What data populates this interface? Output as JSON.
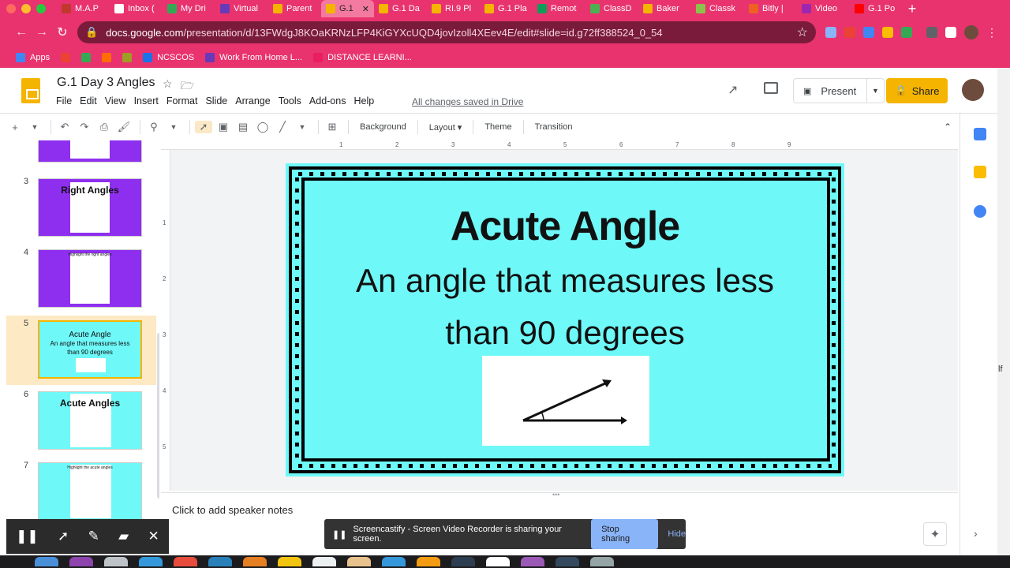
{
  "browser": {
    "tabs": [
      {
        "label": "M.A.P",
        "color": "#c0392b"
      },
      {
        "label": "Inbox (",
        "color": "#ffffff"
      },
      {
        "label": "My Dri",
        "color": "#34a853"
      },
      {
        "label": "Virtual",
        "color": "#673ab7"
      },
      {
        "label": "Parent",
        "color": "#f4b400"
      },
      {
        "label": "G.1",
        "color": "#f4b400",
        "active": true
      },
      {
        "label": "G.1 Da",
        "color": "#f4b400"
      },
      {
        "label": "RI.9 Pl",
        "color": "#f4b400"
      },
      {
        "label": "G.1 Pla",
        "color": "#f4b400"
      },
      {
        "label": "Remot",
        "color": "#0f9d58"
      },
      {
        "label": "ClassD",
        "color": "#4caf50"
      },
      {
        "label": "Baker",
        "color": "#f4b400"
      },
      {
        "label": "Classk",
        "color": "#8bc34a"
      },
      {
        "label": "Bitly |",
        "color": "#ee6123"
      },
      {
        "label": "Video",
        "color": "#9c27b0"
      },
      {
        "label": "G.1 Po",
        "color": "#ff0000"
      }
    ],
    "url_host": "docs.google.com",
    "url_path": "/presentation/d/13FWdgJ8KOaKRNzLFP4KiGYXcUQD4jovIzoll4XEev4E/edit#slide=id.g72ff388524_0_54",
    "bookmarks": [
      {
        "label": "Apps",
        "color": "#4285f4"
      },
      {
        "label": "",
        "color": "#ea4335"
      },
      {
        "label": "",
        "color": "#34a853"
      },
      {
        "label": "",
        "color": "#ff6d00"
      },
      {
        "label": "",
        "color": "#9e9d24"
      },
      {
        "label": "NCSCOS",
        "color": "#1a73e8"
      },
      {
        "label": "Work From Home L...",
        "color": "#673ab7"
      },
      {
        "label": "DISTANCE LEARNI...",
        "color": "#e91e63"
      }
    ]
  },
  "app": {
    "title": "G.1 Day 3 Angles",
    "menus": [
      "File",
      "Edit",
      "View",
      "Insert",
      "Format",
      "Slide",
      "Arrange",
      "Tools",
      "Add-ons",
      "Help"
    ],
    "save_status": "All changes saved in Drive",
    "present_label": "Present",
    "share_label": "Share",
    "toolbar_text_buttons": [
      "Background",
      "Layout",
      "Theme",
      "Transition"
    ]
  },
  "filmstrip": {
    "slides": [
      {
        "num": "",
        "bg": "purple",
        "title": "",
        "sub": ""
      },
      {
        "num": "3",
        "bg": "purple",
        "title": "Right Angles",
        "sub": ""
      },
      {
        "num": "4",
        "bg": "purple",
        "title": "",
        "sub": "Highlight the right angles"
      },
      {
        "num": "5",
        "bg": "cyan",
        "title": "Acute Angle",
        "sub": "An angle that measures less than 90 degrees",
        "selected": true
      },
      {
        "num": "6",
        "bg": "cyan",
        "title": "Acute Angles",
        "sub": ""
      },
      {
        "num": "7",
        "bg": "cyan",
        "title": "",
        "sub": "Highlight the acute angles"
      }
    ]
  },
  "ruler": {
    "h_ticks": [
      "1",
      "2",
      "3",
      "4",
      "5",
      "6",
      "7",
      "8",
      "9"
    ],
    "v_ticks": [
      "1",
      "2",
      "3",
      "4",
      "5"
    ]
  },
  "slide": {
    "heading": "Acute Angle",
    "body_line1": "An angle that measures less",
    "body_line2": "than 90 degrees",
    "background": "#6ff8f8"
  },
  "notes": {
    "placeholder": "Click to add speaker notes"
  },
  "screencastify": {
    "message": "Screencastify - Screen Video Recorder is sharing your screen.",
    "stop_label": "Stop sharing",
    "hide_label": "Hide"
  },
  "colors": {
    "chrome_accent": "#e8336f",
    "slides_yellow": "#f4b400"
  }
}
